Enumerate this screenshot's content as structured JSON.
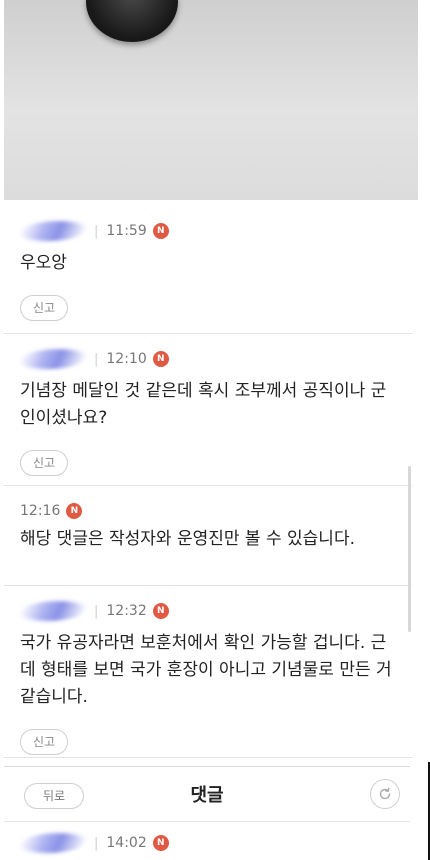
{
  "comments": [
    {
      "time": "11:59",
      "badge": "N",
      "text": "우오앙",
      "report_label": "신고"
    },
    {
      "time": "12:10",
      "badge": "N",
      "text": "기념장 메달인 것 같은데 혹시 조부께서 공직이나 군인이셨나요?",
      "report_label": "신고"
    },
    {
      "time": "12:16",
      "badge": "N",
      "text": "해당 댓글은 작성자와 운영진만 볼 수 있습니다."
    },
    {
      "time": "12:32",
      "badge": "N",
      "text": "국가 유공자라면 보훈처에서 확인 가능할 겁니다. 근데 형태를 보면 국가 훈장이 아니고 기념물로 만든 거 같습니다.",
      "report_label": "신고"
    }
  ],
  "bottom_bar": {
    "back_label": "뒤로",
    "title": "댓글"
  },
  "partial_comment": {
    "time": "14:02",
    "badge": "N"
  },
  "icons": {
    "badge": "n-badge-icon",
    "refresh": "refresh-icon"
  },
  "colors": {
    "badge": "#e05a43",
    "avatar_blur": "#6e78e6"
  }
}
